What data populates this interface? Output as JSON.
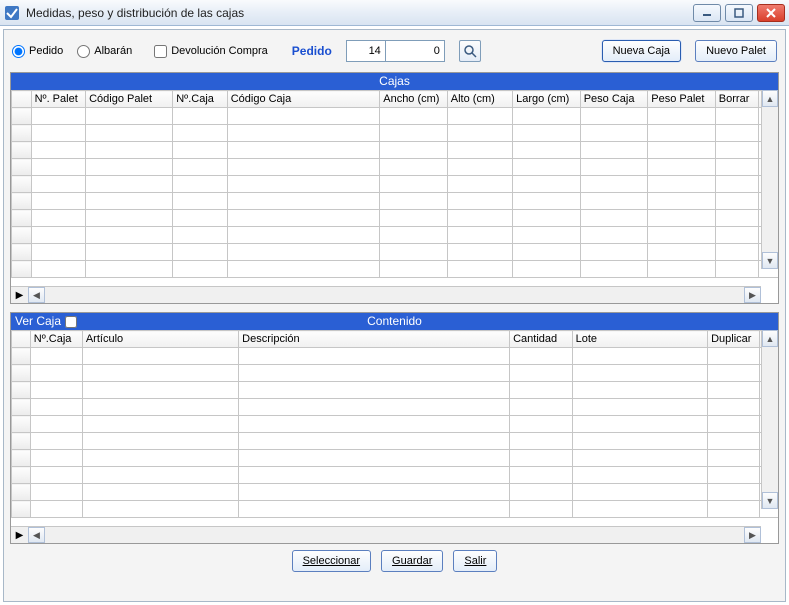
{
  "window": {
    "title": "Medidas, peso y distribución de las cajas"
  },
  "controls": {
    "radio_pedido": "Pedido",
    "radio_albaran": "Albarán",
    "radio_selected": "pedido",
    "chk_devolucion": "Devolución Compra",
    "chk_devolucion_checked": false,
    "label_pedido": "Pedido",
    "input_pedido_a": "14",
    "input_pedido_b": "0",
    "btn_nueva_caja": "Nueva Caja",
    "btn_nuevo_palet": "Nuevo Palet"
  },
  "grid_cajas": {
    "title": "Cajas",
    "columns": [
      "Nº. Palet",
      "Código Palet",
      "Nº.Caja",
      "Código Caja",
      "Ancho (cm)",
      "Alto (cm)",
      "Largo (cm)",
      "Peso Caja",
      "Peso Palet",
      "Borrar"
    ]
  },
  "grid_contenido": {
    "title_left_label": "Ver Caja",
    "title_center": "Contenido",
    "ver_caja_checked": false,
    "columns": [
      "Nº.Caja",
      "Artículo",
      "Descripción",
      "Cantidad",
      "Lote",
      "Duplicar"
    ]
  },
  "footer": {
    "btn_seleccionar": "Seleccionar",
    "btn_guardar": "Guardar",
    "btn_salir": "Salir"
  }
}
